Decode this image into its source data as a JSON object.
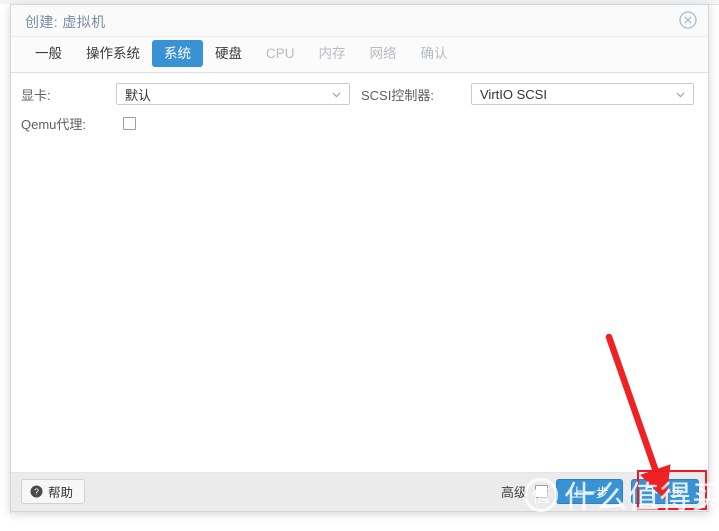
{
  "dialog": {
    "title": "创建: 虚拟机",
    "close_icon": "close-circle-icon"
  },
  "tabs": [
    {
      "label": "一般",
      "state": "enabled"
    },
    {
      "label": "操作系统",
      "state": "enabled"
    },
    {
      "label": "系统",
      "state": "active"
    },
    {
      "label": "硬盘",
      "state": "enabled"
    },
    {
      "label": "CPU",
      "state": "disabled"
    },
    {
      "label": "内存",
      "state": "disabled"
    },
    {
      "label": "网络",
      "state": "disabled"
    },
    {
      "label": "确认",
      "state": "disabled"
    }
  ],
  "form": {
    "graphics": {
      "label": "显卡:",
      "value": "默认"
    },
    "scsi_controller": {
      "label": "SCSI控制器:",
      "value": "VirtIO SCSI"
    },
    "qemu_agent": {
      "label": "Qemu代理:",
      "checked": false
    }
  },
  "footer": {
    "help_label": "帮助",
    "help_icon": "question-circle-icon",
    "advanced_label": "高级",
    "advanced_checked": false,
    "back_label": "上一步",
    "next_label": "下一步"
  },
  "annotation": {
    "arrow_color": "#ee2222",
    "box_color": "#e81c24"
  },
  "watermark": {
    "logo_char": "值",
    "text": "什么值得买"
  },
  "colors": {
    "accent": "#3892d4",
    "title_text": "#7a8ba8",
    "footer_bg": "#ebebeb"
  }
}
